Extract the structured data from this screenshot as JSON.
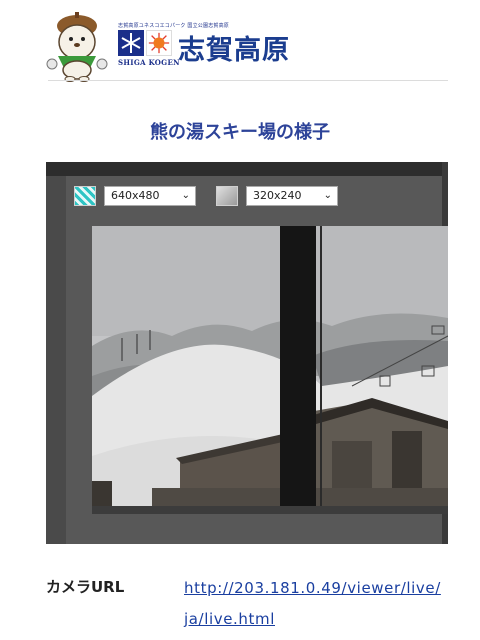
{
  "header": {
    "small_caption": "志賀高原ユネスコエコパーク 国立公園志賀高原",
    "emblem_label": "SHIGA KOGEN",
    "brand_title": "志賀高原"
  },
  "page": {
    "title": "熊の湯スキー場の様子"
  },
  "camera": {
    "resolution_options": [
      "640x480",
      "320x240"
    ]
  },
  "info": {
    "label": "カメラURL",
    "url": "http://203.181.0.49/viewer/live/ja/live.html"
  }
}
